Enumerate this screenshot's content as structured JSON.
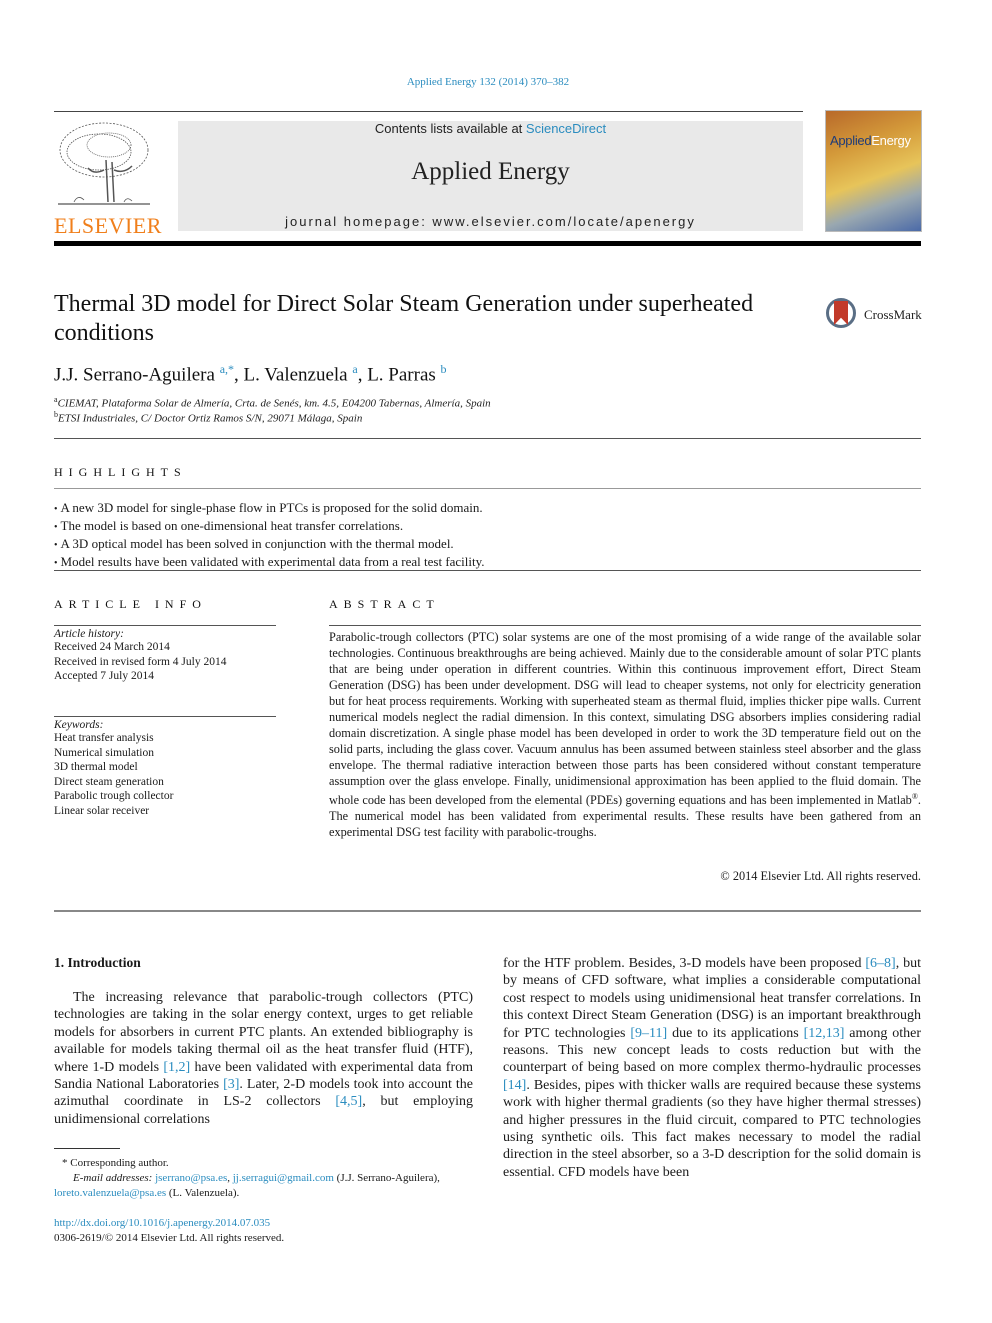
{
  "header": {
    "citation": "Applied Energy 132 (2014) 370–382",
    "publisher_logo_text": "ELSEVIER",
    "contents_prefix": "Contents lists available at ",
    "contents_link": "ScienceDirect",
    "journal_name": "Applied Energy",
    "homepage": "journal homepage: www.elsevier.com/locate/apenergy",
    "cover_title_a": "Applied",
    "cover_title_b": "Energy",
    "crossmark_label": "CrossMark"
  },
  "article": {
    "title": "Thermal 3D model for Direct Solar Steam Generation under superheated conditions",
    "authors": [
      {
        "name": "J.J. Serrano-Aguilera",
        "sup": "a,*"
      },
      {
        "name": "L. Valenzuela",
        "sup": "a"
      },
      {
        "name": "L. Parras",
        "sup": "b"
      }
    ],
    "affiliations": [
      {
        "sup": "a",
        "text": "CIEMAT, Plataforma Solar de Almería, Crta. de Senés, km. 4.5, E04200 Tabernas, Almería, Spain"
      },
      {
        "sup": "b",
        "text": "ETSI Industriales, C/ Doctor Ortiz Ramos S/N, 29071 Málaga, Spain"
      }
    ]
  },
  "highlights": {
    "heading": "HIGHLIGHTS",
    "items": [
      "A new 3D model for single-phase flow in PTCs is proposed for the solid domain.",
      "The model is based on one-dimensional heat transfer correlations.",
      "A 3D optical model has been solved in conjunction with the thermal model.",
      "Model results have been validated with experimental data from a real test facility."
    ]
  },
  "article_info": {
    "heading": "ARTICLE INFO",
    "history_label": "Article history:",
    "history": [
      "Received 24 March 2014",
      "Received in revised form 4 July 2014",
      "Accepted 7 July 2014"
    ],
    "keywords_label": "Keywords:",
    "keywords": [
      "Heat transfer analysis",
      "Numerical simulation",
      "3D thermal model",
      "Direct steam generation",
      "Parabolic trough collector",
      "Linear solar receiver"
    ]
  },
  "abstract": {
    "heading": "ABSTRACT",
    "text_a": "Parabolic-trough collectors (PTC) solar systems are one of the most promising of a wide range of the available solar technologies. Continuous breakthroughs are being achieved. Mainly due to the considerable amount of solar PTC plants that are being under operation in different countries. Within this continuous improvement effort, Direct Steam Generation (DSG) has been under development. DSG will lead to cheaper systems, not only for electricity generation but for heat process requirements. Working with superheated steam as thermal fluid, implies thicker pipe walls. Current numerical models neglect the radial dimension. In this context, simulating DSG absorbers implies considering radial domain discretization. A single phase model has been developed in order to work the 3D temperature field out on the solid parts, including the glass cover. Vacuum annulus has been assumed between stainless steel absorber and the glass envelope. The thermal radiative interaction between those parts has been considered without constant temperature assumption over the glass envelope. Finally, unidimensional approximation has been applied to the fluid domain. The whole code has been developed from the elemental (PDEs) governing equations and has been implemented in Matlab",
    "registered": "®",
    "text_b": ". The numerical model has been validated from experimental results. These results have been gathered from an experimental DSG test facility with parabolic-troughs.",
    "copyright": "© 2014 Elsevier Ltd. All rights reserved."
  },
  "introduction": {
    "heading": "1. Introduction",
    "left": [
      {
        "t": "The increasing relevance that parabolic-trough collectors (PTC) technologies are taking in the solar energy context, urges to get reliable models for absorbers in current PTC plants. An extended bibliography is available for models taking thermal oil as the heat transfer fluid (HTF), where 1-D models "
      },
      {
        "ref": "[1,2]"
      },
      {
        "t": " have been validated with experimental data from Sandia National Laboratories "
      },
      {
        "ref": "[3]"
      },
      {
        "t": ". Later, 2-D models took into account the azimuthal coordinate in LS-2 collectors "
      },
      {
        "ref": "[4,5]"
      },
      {
        "t": ", but employing unidimensional correlations"
      }
    ],
    "right": [
      {
        "t": "for the HTF problem. Besides, 3-D models have been proposed "
      },
      {
        "ref": "[6–8]"
      },
      {
        "t": ", but by means of CFD software, what implies a considerable computational cost respect to models using unidimensional heat transfer correlations. In this context Direct Steam Generation (DSG) is an important breakthrough for PTC technologies "
      },
      {
        "ref": "[9–11]"
      },
      {
        "t": " due to its applications "
      },
      {
        "ref": "[12,13]"
      },
      {
        "t": " among other reasons. This new concept leads to costs reduction but with the counterpart of being based on more complex thermo-hydraulic processes "
      },
      {
        "ref": "[14]"
      },
      {
        "t": ". Besides, pipes with thicker walls are required because these systems work with higher thermal gradients (so they have higher thermal stresses) and higher pressures in the fluid circuit, compared to PTC technologies using synthetic oils. This fact makes necessary to model the radial direction in the steel absorber, so a 3-D description for the solid domain is essential. CFD models have been"
      }
    ]
  },
  "footnotes": {
    "corresponding": "* Corresponding author.",
    "email_label": "E-mail addresses:",
    "email1": "jserrano@psa.es",
    "email2": "jj.serragui@gmail.com",
    "email2_owner": " (J.J. Serrano-Aguilera),",
    "email3": "loreto.valenzuela@psa.es",
    "email3_owner": " (L. Valenzuela).",
    "doi": "http://dx.doi.org/10.1016/j.apenergy.2014.07.035",
    "issn": "0306-2619/© 2014 Elsevier Ltd. All rights reserved."
  }
}
